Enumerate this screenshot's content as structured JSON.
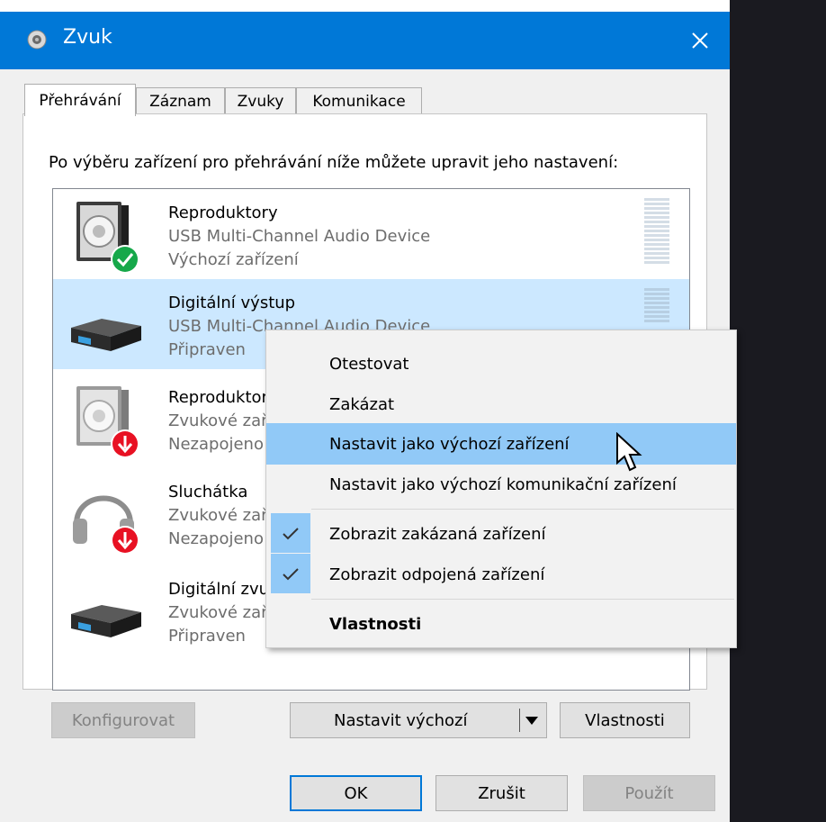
{
  "window": {
    "title": "Zvuk",
    "close_label": "✕"
  },
  "tabs": [
    {
      "label": "Přehrávání",
      "active": true
    },
    {
      "label": "Záznam"
    },
    {
      "label": "Zvuky"
    },
    {
      "label": "Komunikace"
    }
  ],
  "instruction": "Po výběru zařízení pro přehrávání níže můžete upravit jeho nastavení:",
  "devices": [
    {
      "name": "Reproduktory",
      "line2": "USB Multi-Channel Audio Device",
      "line3": "Výchozí zařízení",
      "icon": "speaker-default-icon"
    },
    {
      "name": "Digitální výstup",
      "line2": "USB Multi-Channel Audio Device",
      "line3": "Připraven",
      "icon": "digital-output-icon",
      "selected": true
    },
    {
      "name": "Reproduktory",
      "line2": "Zvukové zařízení",
      "line3": "Nezapojeno",
      "icon": "speaker-unplugged-icon"
    },
    {
      "name": "Sluchátka",
      "line2": "Zvukové zařízení",
      "line3": "Nezapojeno",
      "icon": "headphones-unplugged-icon"
    },
    {
      "name": "Digitální zvuk",
      "line2": "Zvukové zařízení",
      "line3": "Připraven",
      "icon": "digital-output-icon"
    }
  ],
  "buttons": {
    "configure": "Konfigurovat",
    "set_default": "Nastavit výchozí",
    "properties": "Vlastnosti",
    "ok": "OK",
    "cancel": "Zrušit",
    "apply": "Použít"
  },
  "context_menu": {
    "items": [
      {
        "label": "Otestovat"
      },
      {
        "label": "Zakázat"
      },
      {
        "label": "Nastavit jako výchozí zařízení",
        "highlighted": true
      },
      {
        "label": "Nastavit jako výchozí komunikační zařízení"
      },
      {
        "label": "Zobrazit zakázaná zařízení",
        "checked": true
      },
      {
        "label": "Zobrazit odpojená zařízení",
        "checked": true
      },
      {
        "label": "Vlastnosti",
        "bold": true
      }
    ]
  },
  "colors": {
    "titlebar": "#0078d7",
    "selection": "#cce8ff",
    "menu_highlight": "#91c9f7",
    "default_badge": "#16a84a",
    "unplugged_badge": "#e81123"
  }
}
